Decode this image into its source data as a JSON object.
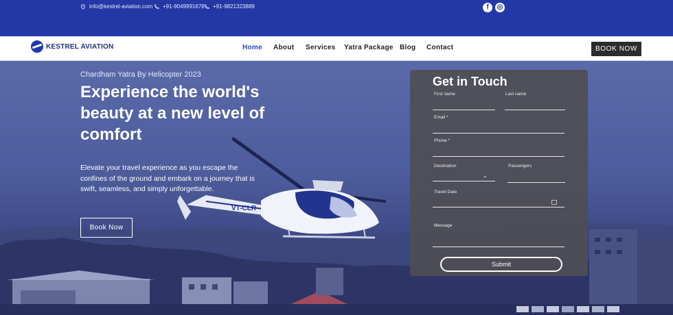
{
  "topbar": {
    "email": "info@kestrel-aviation.com",
    "phone1": "+91-9049991678",
    "phone2": "+91-9821323889",
    "social": [
      {
        "icon": "facebook-icon",
        "glyph": "f"
      },
      {
        "icon": "instagram-icon",
        "glyph": "◎"
      }
    ]
  },
  "nav": {
    "brand": "KESTREL AVIATION",
    "items": [
      "Home",
      "About",
      "Services",
      "Yatra Package",
      "Blog",
      "Contact"
    ],
    "active": "Home",
    "cta": "BOOK NOW"
  },
  "hero": {
    "subtitle": "Chardham Yatra By Helicopter 2023",
    "title": "Experience the world's beauty at a new level of comfort",
    "description": "Elevate your travel experience as you escape the confines of the ground and embark on a journey that is swift, seamless, and simply unforgettable.",
    "button": "Book Now",
    "helicopter_reg": "VT-CLR"
  },
  "form": {
    "title": "Get in Touch",
    "first_name": "First name",
    "last_name": "Last name",
    "email": "Email *",
    "phone": "Phone *",
    "destination": "Destination",
    "passengers": "Passengers",
    "travel_date": "Travel Date",
    "message": "Message",
    "submit": "Submit"
  },
  "colors": {
    "topbar": "#2337a6",
    "nav_active": "#2b46b5",
    "cta_bg": "#2c2c2c",
    "form_bg": "#4e4e54"
  }
}
